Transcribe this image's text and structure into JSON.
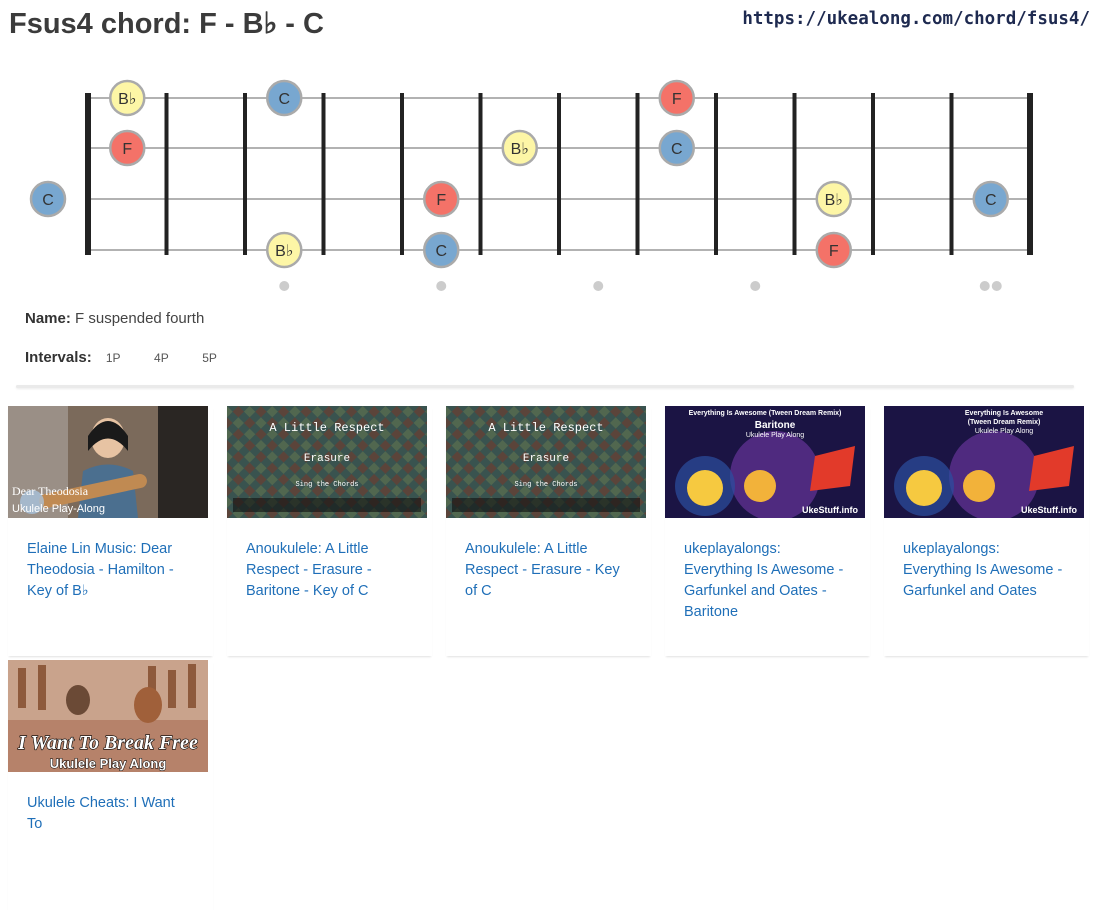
{
  "header": {
    "title": "Fsus4 chord: F - B♭ - C",
    "url": "https://ukealong.com/chord/fsus4/"
  },
  "colors": {
    "F": "#f47268",
    "Bb": "#fdf6a6",
    "C": "#78a7d0",
    "marker_stroke": "#aaaaaa",
    "fret_line": "#222222",
    "string_line": "#999999",
    "inlay_dot": "#cccccc",
    "link": "#1f6fb8"
  },
  "fretboard": {
    "frets": 12,
    "strings": 4,
    "inlay_frets": [
      3,
      5,
      7,
      9,
      12
    ],
    "notes": [
      {
        "string": 1,
        "fret": 1,
        "label": "B♭",
        "type": "Bb"
      },
      {
        "string": 1,
        "fret": 3,
        "label": "C",
        "type": "C"
      },
      {
        "string": 1,
        "fret": 8,
        "label": "F",
        "type": "F"
      },
      {
        "string": 2,
        "fret": 1,
        "label": "F",
        "type": "F"
      },
      {
        "string": 2,
        "fret": 6,
        "label": "B♭",
        "type": "Bb"
      },
      {
        "string": 2,
        "fret": 8,
        "label": "C",
        "type": "C"
      },
      {
        "string": 3,
        "fret": 0,
        "label": "C",
        "type": "C"
      },
      {
        "string": 3,
        "fret": 5,
        "label": "F",
        "type": "F"
      },
      {
        "string": 3,
        "fret": 10,
        "label": "B♭",
        "type": "Bb"
      },
      {
        "string": 3,
        "fret": 12,
        "label": "C",
        "type": "C"
      },
      {
        "string": 4,
        "fret": 3,
        "label": "B♭",
        "type": "Bb"
      },
      {
        "string": 4,
        "fret": 5,
        "label": "C",
        "type": "C"
      },
      {
        "string": 4,
        "fret": 10,
        "label": "F",
        "type": "F"
      }
    ]
  },
  "info": {
    "name_label": "Name:",
    "name_value": "F suspended fourth",
    "intervals_label": "Intervals:",
    "intervals": [
      "1P",
      "4P",
      "5P"
    ]
  },
  "videos": [
    {
      "title": "Elaine Lin Music: Dear Theodosia - Hamilton - Key of B♭",
      "thumb_line1": "Dear Theodosia",
      "thumb_line2": "Ukulele Play-Along",
      "thumb_style": "portrait"
    },
    {
      "title": "Anoukulele: A Little Respect - Erasure - Baritone - Key of C",
      "thumb_line1": "A Little Respect",
      "thumb_line2": "Erasure",
      "thumb_line3": "Sing the Chords",
      "thumb_style": "tiles"
    },
    {
      "title": "Anoukulele: A Little Respect - Erasure - Key of C",
      "thumb_line1": "A Little Respect",
      "thumb_line2": "Erasure",
      "thumb_line3": "Sing the Chords",
      "thumb_style": "tiles"
    },
    {
      "title": "ukeplayalongs: Everything Is Awesome - Garfunkel and Oates - Baritone",
      "thumb_line1": "Everything Is Awesome (Tween Dream Remix)",
      "thumb_line2": "Baritone",
      "thumb_line3": "Ukulele Play Along",
      "thumb_brand": "UkeStuff.info",
      "thumb_style": "lego"
    },
    {
      "title": "ukeplayalongs: Everything Is Awesome - Garfunkel and Oates",
      "thumb_line1": "Everything Is Awesome",
      "thumb_line2": "(Tween Dream Remix)",
      "thumb_line3": "Ukulele Play Along",
      "thumb_brand": "UkeStuff.info",
      "thumb_style": "lego"
    },
    {
      "title": "Ukulele Cheats: I Want To",
      "thumb_line1": "I Want To Break Free",
      "thumb_line2": "Ukulele Play Along",
      "thumb_style": "free"
    }
  ]
}
